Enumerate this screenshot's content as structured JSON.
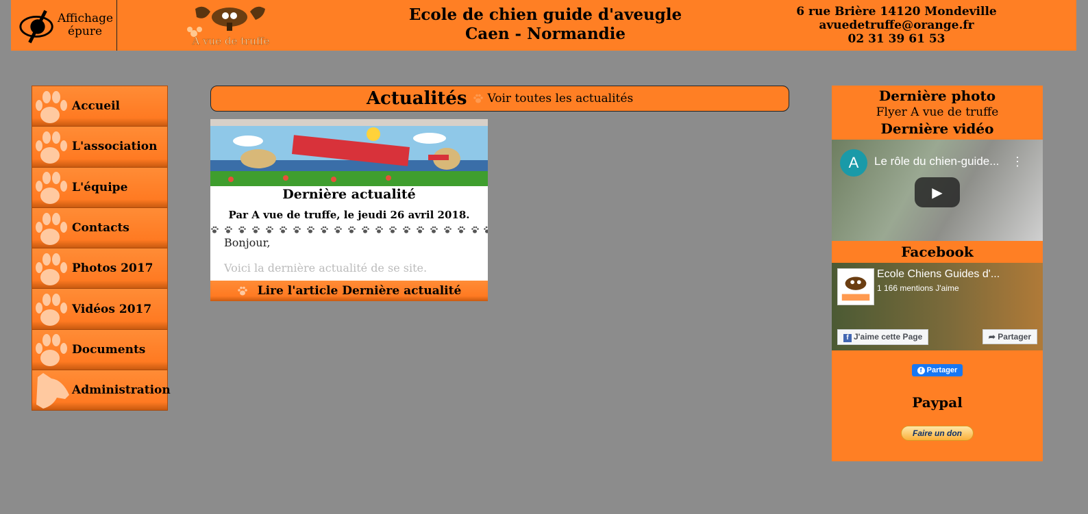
{
  "header": {
    "epure_label": "Affichage épure",
    "title_line1": "Ecole de chien guide d'aveugle",
    "title_line2": "Caen - Normandie",
    "address": "6 rue Brière 14120 Mondeville",
    "email": "avuedetruffe@orange.fr",
    "phone": "02 31 39 61 53",
    "logo_text": "A vue de truffe"
  },
  "nav": {
    "items": [
      {
        "label": "Accueil",
        "icon": "paw-icon"
      },
      {
        "label": "L'association",
        "icon": "paw-icon"
      },
      {
        "label": "L'équipe",
        "icon": "paw-icon"
      },
      {
        "label": "Contacts",
        "icon": "paw-icon"
      },
      {
        "label": "Photos 2017",
        "icon": "paw-icon"
      },
      {
        "label": "Vidéos 2017",
        "icon": "paw-icon"
      },
      {
        "label": "Documents",
        "icon": "paw-icon"
      },
      {
        "label": "Administration",
        "icon": "dog-head-icon"
      }
    ]
  },
  "actualites": {
    "title": "Actualités",
    "see_all": "Voir toutes les actualités",
    "card": {
      "title": "Dernière actualité",
      "meta": "Par A vue de truffe, le jeudi 26 avril 2018.",
      "greeting": "Bonjour,",
      "excerpt": "Voici la dernière actualité de se site.",
      "read_more": "Lire l'article Dernière actualité"
    }
  },
  "right": {
    "photo_heading": "Dernière photo",
    "photo_caption": "Flyer A vue de truffe",
    "video_heading": "Dernière vidéo",
    "video": {
      "avatar": "A",
      "title": "Le rôle du chien-guide...",
      "menu": "⋮",
      "play": "▶"
    },
    "facebook_heading": "Facebook",
    "facebook": {
      "page_name": "Ecole Chiens Guides d'...",
      "likes": "1 166 mentions J'aime",
      "like_button": "J'aime cette Page",
      "share_button": "Partager",
      "share_plugin": "Partager"
    },
    "paypal_heading": "Paypal",
    "paypal_button": "Faire un don"
  },
  "colors": {
    "orange": "#ff7f24",
    "background": "#8c8c8c"
  }
}
